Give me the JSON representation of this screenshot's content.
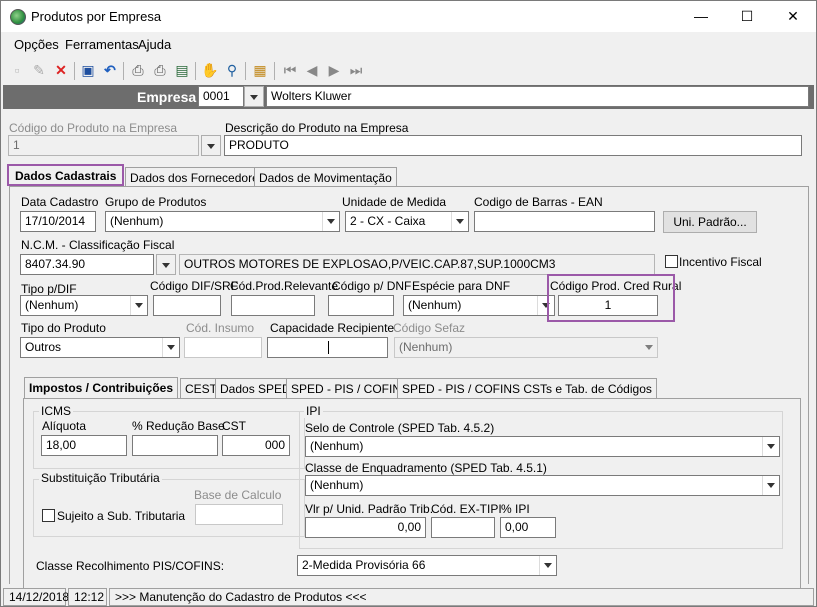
{
  "window": {
    "title": "Produtos por Empresa",
    "minimize": "—",
    "maximize": "☐",
    "close": "✕"
  },
  "menu": [
    "Opções",
    "Ferramentas",
    "Ajuda"
  ],
  "empresa": {
    "label": "Empresa",
    "code": "0001",
    "name": "Wolters Kluwer"
  },
  "produto": {
    "codigo_label": "Código do Produto na Empresa",
    "codigo_value": "1",
    "descricao_label": "Descrição do Produto na Empresa",
    "descricao_value": "PRODUTO"
  },
  "main_tabs": [
    "Dados Cadastrais",
    "Dados dos Fornecedores",
    "Dados de Movimentação"
  ],
  "dados": {
    "data_cadastro_label": "Data Cadastro",
    "data_cadastro_value": "17/10/2014",
    "grupo_label": "Grupo de Produtos",
    "grupo_value": "(Nenhum)",
    "unidade_label": "Unidade de Medida",
    "unidade_value": "2 - CX - Caixa",
    "ean_label": "Codigo de Barras - EAN",
    "ean_value": "",
    "uni_padrao_button": "Uni. Padrão...",
    "ncm_label": "N.C.M. -  Classificação Fiscal",
    "ncm_value": "8407.34.90",
    "ncm_desc": "OUTROS MOTORES DE EXPLOSAO,P/VEIC.CAP.87,SUP.1000CM3",
    "incentivo_label": "Incentivo Fiscal",
    "tipo_dif_label": "Tipo p/DIF",
    "tipo_dif_value": "(Nenhum)",
    "cod_dif_label": "Código DIF/SRF",
    "cod_prod_rel_label": "Cód.Prod.Relevante",
    "cod_dnf_label": "Código p/ DNF",
    "especie_dnf_label": "Espécie para DNF",
    "especie_dnf_value": "(Nenhum)",
    "cred_rural_label": "Código Prod. Cred Rural",
    "cred_rural_value": "1",
    "tipo_produto_label": "Tipo do Produto",
    "tipo_produto_value": "Outros",
    "cod_insumo_label": "Cód. Insumo",
    "capacidade_label": "Capacidade Recipiente",
    "cod_sefaz_label": "Código Sefaz",
    "cod_sefaz_value": "(Nenhum)"
  },
  "sub_tabs": [
    "Impostos / Contribuições",
    "CEST",
    "Dados SPED",
    "SPED - PIS / COFINS",
    "SPED - PIS / COFINS CSTs e Tab. de Códigos"
  ],
  "icms": {
    "title": "ICMS",
    "aliquota_label": "Alíquota",
    "aliquota_value": "18,00",
    "reducao_label": "% Redução Base",
    "reducao_value": "",
    "cst_label": "CST",
    "cst_value": "000"
  },
  "subst": {
    "title": "Substituição Tributária",
    "base_label": "Base de Calculo",
    "sujeito_label": "Sujeito a Sub. Tributaria"
  },
  "ipi": {
    "title": "IPI",
    "selo_label": "Selo de Controle (SPED Tab. 4.5.2)",
    "selo_value": "(Nenhum)",
    "classe_label": "Classe de Enquadramento (SPED Tab. 4.5.1)",
    "classe_value": "(Nenhum)",
    "vlr_label": "Vlr p/ Unid. Padrão Trib.",
    "vlr_value": "0,00",
    "ex_tipi_label": "Cód. EX-TIPI",
    "ex_tipi_value": "",
    "pct_label": "% IPI",
    "pct_value": "0,00"
  },
  "pis": {
    "label": "Classe Recolhimento PIS/COFINS:",
    "value": "2-Medida Provisória 66"
  },
  "status": {
    "date": "14/12/2018",
    "time": "12:12",
    "message": ">>> Manutenção do Cadastro de Produtos <<<"
  }
}
